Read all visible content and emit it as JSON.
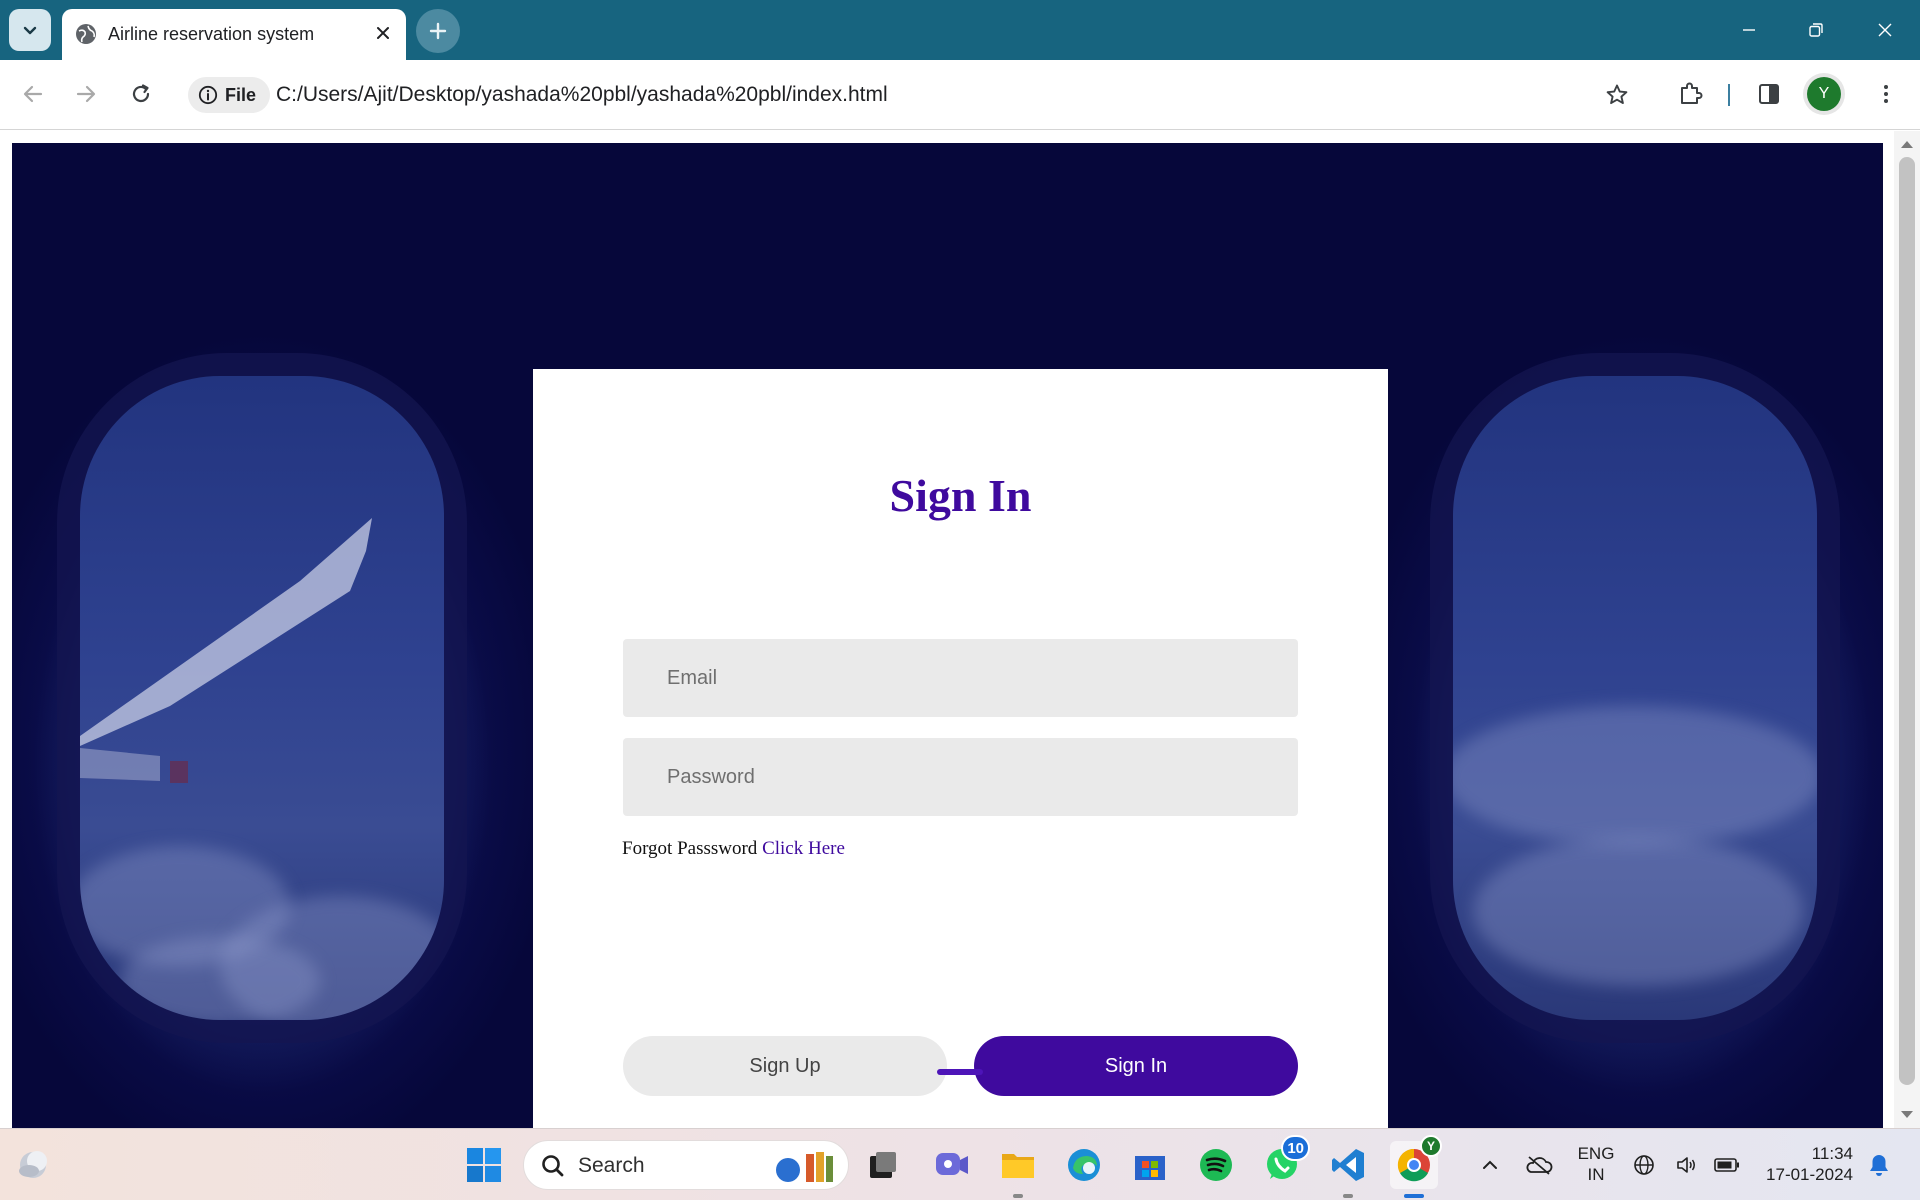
{
  "browser": {
    "tab_title": "Airline reservation system",
    "url_scheme_label": "File",
    "url": "C:/Users/Ajit/Desktop/yashada%20pbl/yashada%20pbl/index.html",
    "profile_initial": "Y",
    "theme_color": "#17647f"
  },
  "page": {
    "title": "Sign In",
    "email_placeholder": "Email",
    "password_placeholder": "Password",
    "forgot_text": "Forgot Passsword",
    "forgot_link": "Click Here",
    "signup_label": "Sign Up",
    "signin_label": "Sign In",
    "accent_color": "#3f0a9e"
  },
  "taskbar": {
    "search_label": "Search",
    "whatsapp_badge": "10",
    "chrome_profile_initial": "Y",
    "lang_line1": "ENG",
    "lang_line2": "IN",
    "time": "11:34",
    "date": "17-01-2024"
  }
}
